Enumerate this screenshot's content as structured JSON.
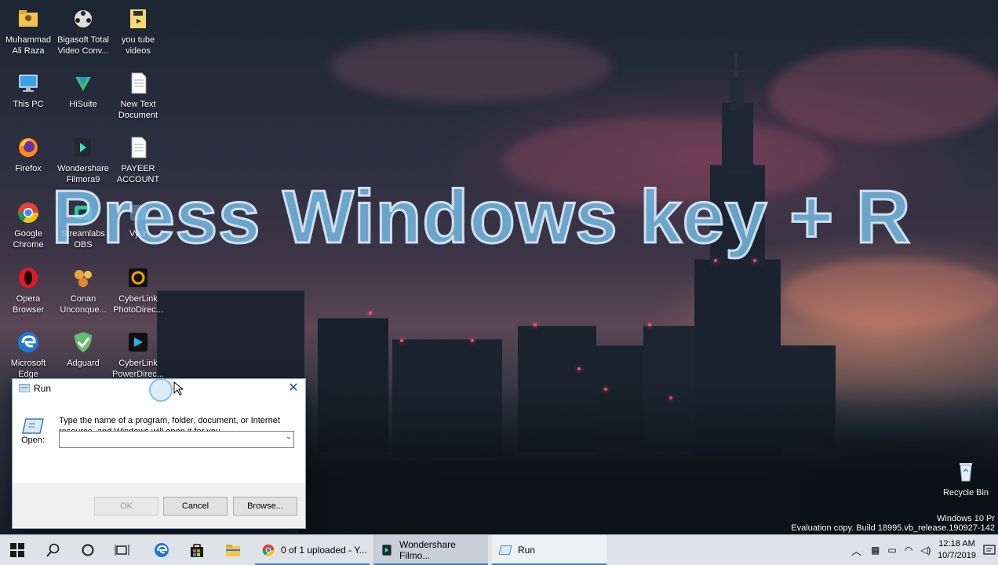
{
  "overlay": {
    "caption": "Press Windows key + R"
  },
  "desktop_icons": [
    {
      "label": "Muhammad Ali Raza",
      "icon": "user-folder-icon"
    },
    {
      "label": "Bigasoft Total Video Conv...",
      "icon": "film-reel-icon"
    },
    {
      "label": "you tube videos",
      "icon": "folder-icon"
    },
    {
      "label": "This PC",
      "icon": "computer-icon"
    },
    {
      "label": "HiSuite",
      "icon": "hisuite-icon"
    },
    {
      "label": "New Text Document",
      "icon": "text-document-icon"
    },
    {
      "label": "Firefox",
      "icon": "firefox-icon"
    },
    {
      "label": "Wondershare Filmora9",
      "icon": "filmora-icon"
    },
    {
      "label": "PAYEER ACCOUNT",
      "icon": "text-document-icon"
    },
    {
      "label": "Google Chrome",
      "icon": "chrome-icon"
    },
    {
      "label": "Streamlabs OBS",
      "icon": "streamlabs-icon"
    },
    {
      "label": "Vyor",
      "icon": "app-icon"
    },
    {
      "label": "Opera Browser",
      "icon": "opera-icon"
    },
    {
      "label": "Conan Unconque...",
      "icon": "game-icon"
    },
    {
      "label": "CyberLink PhotoDirec...",
      "icon": "photodirector-icon"
    },
    {
      "label": "Microsoft Edge",
      "icon": "edge-icon"
    },
    {
      "label": "Adguard",
      "icon": "adguard-shield-icon"
    },
    {
      "label": "CyberLink PowerDirec...",
      "icon": "powerdirector-icon"
    },
    {
      "label": "Recycle Bin",
      "icon": "recycle-bin-icon"
    }
  ],
  "run_dialog": {
    "title": "Run",
    "description": "Type the name of a program, folder, document, or Internet resource, and Windows will open it for you.",
    "open_label": "Open:",
    "open_value": "",
    "ok_label": "OK",
    "cancel_label": "Cancel",
    "browse_label": "Browse..."
  },
  "taskbar": {
    "apps": [
      {
        "label": "0 of 1 uploaded - Y...",
        "icon": "chrome-icon"
      },
      {
        "label": "Wondershare Filmo...",
        "icon": "filmora-icon"
      },
      {
        "label": "Run",
        "icon": "run-icon"
      }
    ],
    "time": "12:18 AM",
    "date": "10/7/2019"
  },
  "watermark": {
    "line1": "Windows 10 Pr",
    "line2": "Evaluation copy. Build 18995.vb_release.190927-142"
  },
  "colors": {
    "accent": "#4a7fc1",
    "taskbar": "#dfe3e8"
  }
}
